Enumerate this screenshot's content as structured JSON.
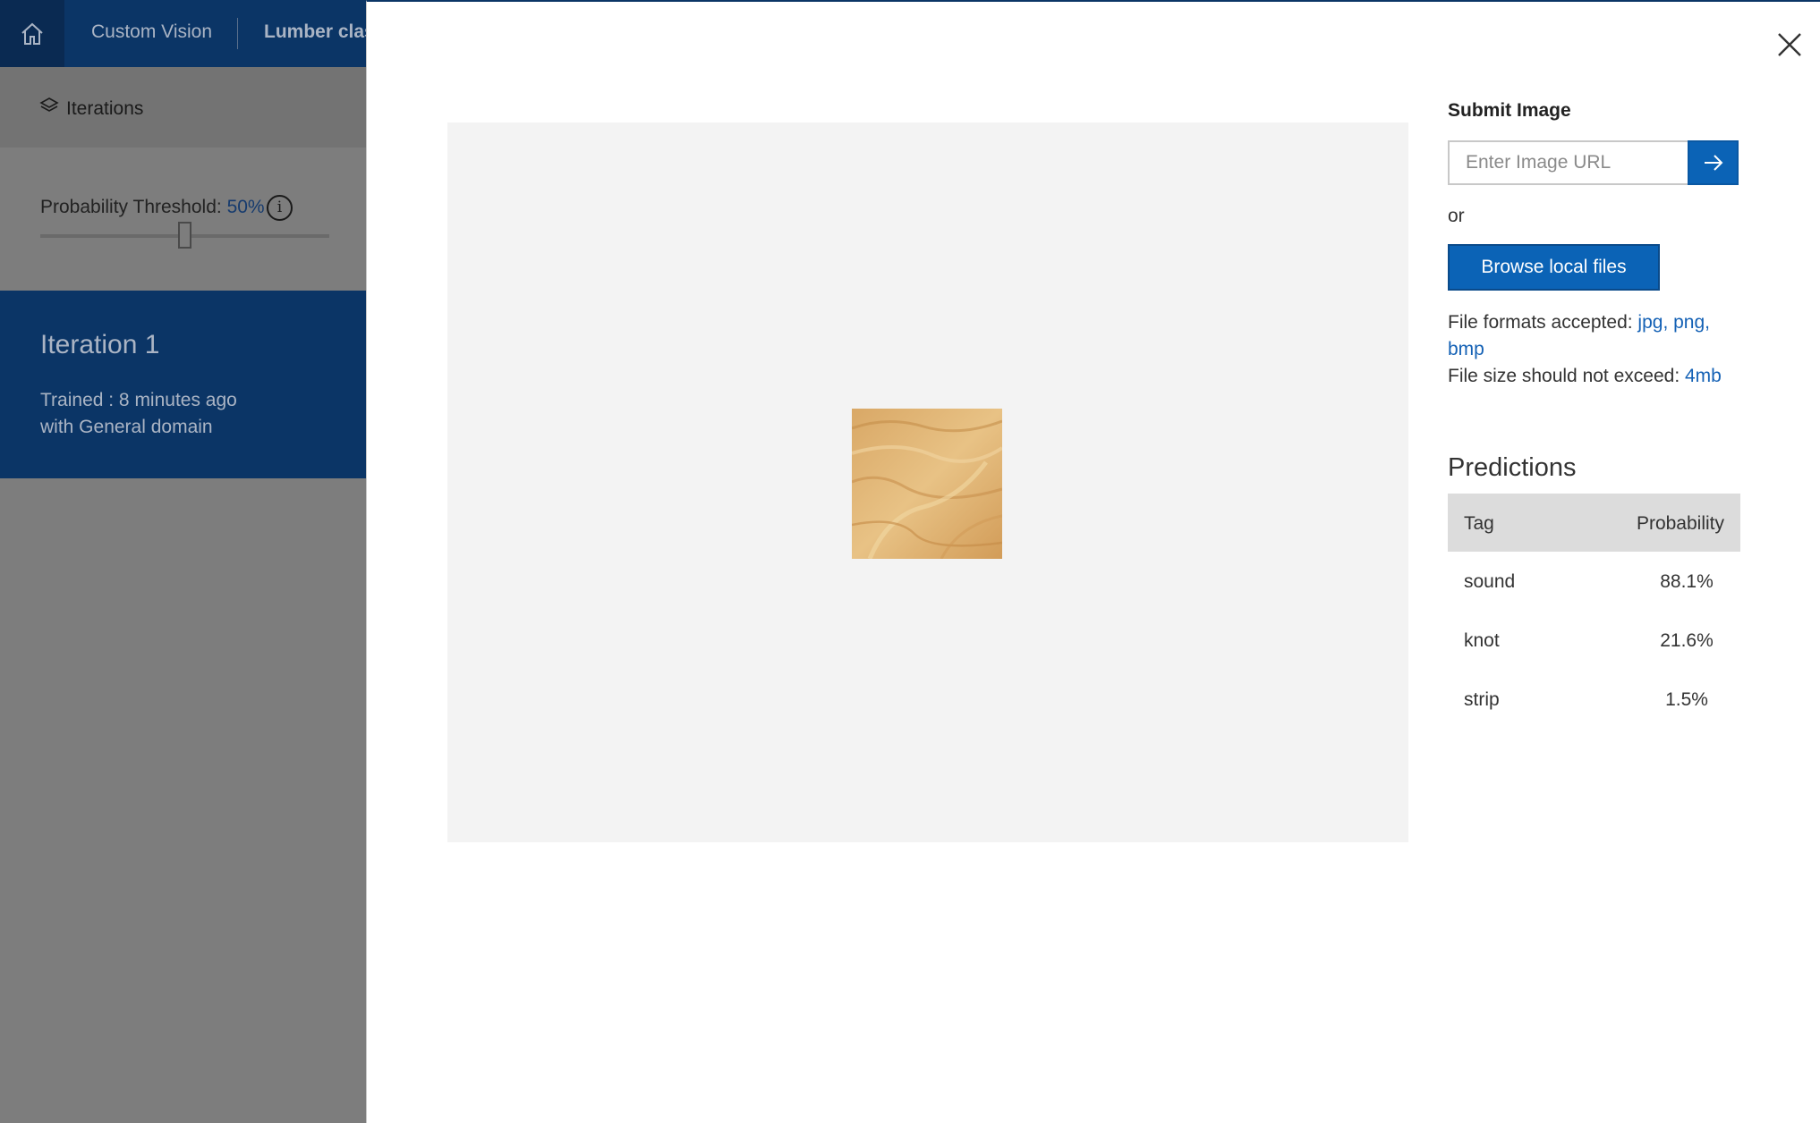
{
  "app": {
    "brand": "Custom Vision",
    "project_name": "Lumber clas",
    "iterations_label": "Iterations",
    "threshold": {
      "label": "Probability Threshold: ",
      "value": "50%",
      "slider_fraction": 0.5
    },
    "iteration_card": {
      "name": "Iteration 1",
      "trained": "Trained : 8 minutes ago",
      "domain": "with General domain"
    }
  },
  "panel": {
    "submit_title": "Submit Image",
    "url_placeholder": "Enter Image URL",
    "or": "or",
    "browse_label": "Browse local files",
    "formats_label": "File formats accepted: ",
    "formats_value_line1": "jpg, png,",
    "formats_value_line2": "bmp",
    "size_label": "File size should not exceed: ",
    "size_value": "4mb",
    "predictions_title": "Predictions",
    "table_headers": {
      "tag": "Tag",
      "probability": "Probability"
    },
    "predictions": [
      {
        "tag": "sound",
        "probability": "88.1%"
      },
      {
        "tag": "knot",
        "probability": "21.6%"
      },
      {
        "tag": "strip",
        "probability": "1.5%"
      }
    ]
  },
  "colors": {
    "nav_blue": "#0b3566",
    "primary_button": "#0b63b6",
    "link": "#1461b5",
    "overlay_gray": "#7d7d7d"
  },
  "icons": [
    "home-icon",
    "layers-icon",
    "info-icon",
    "arrow-right-icon",
    "close-icon"
  ]
}
